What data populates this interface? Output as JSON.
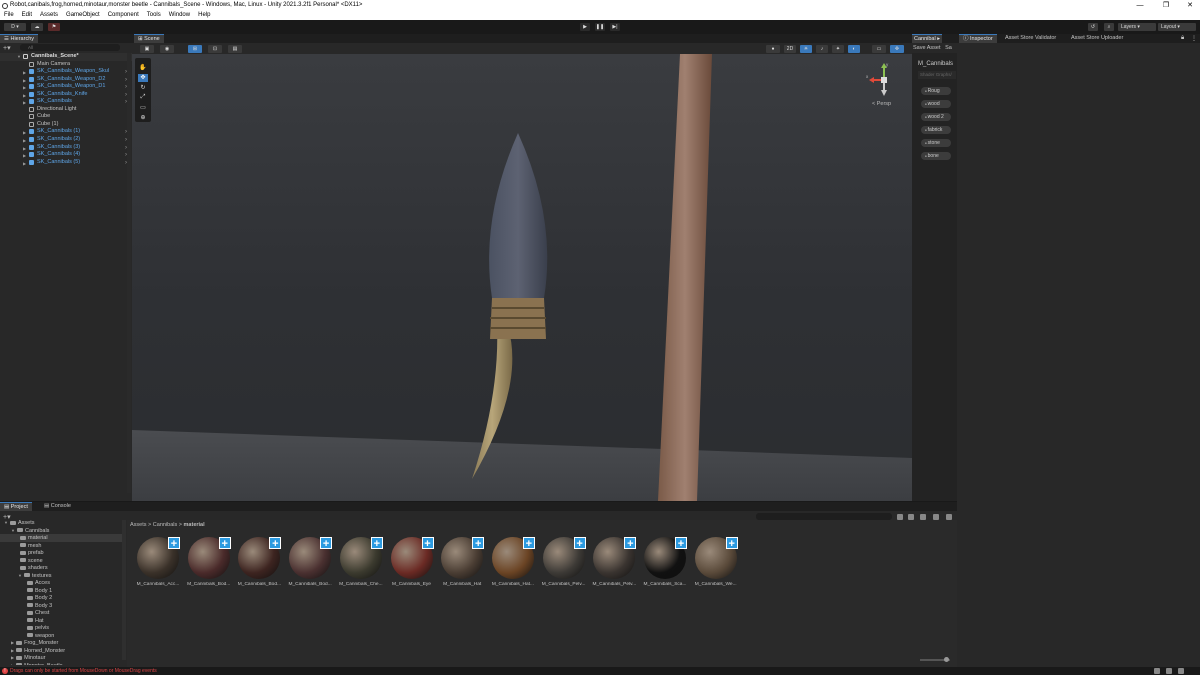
{
  "window": {
    "title": "Robot,canibals,frog,horned,minotaur,monster beetle - Cannibals_Scene - Windows, Mac, Linux - Unity 2021.3.2f1 Personal* <DX11>",
    "minimize": "—",
    "restore": "❐",
    "close": "✕"
  },
  "menu": [
    "File",
    "Edit",
    "Assets",
    "GameObject",
    "Component",
    "Tools",
    "Window",
    "Help"
  ],
  "toolbar": {
    "account": "D ▾",
    "layers": "Layers",
    "layout": "Layout"
  },
  "hierarchy": {
    "tab": "Hierarchy",
    "search_placeholder": "All",
    "scene": "Cannibals_Scene*",
    "items": [
      {
        "label": "Main Camera",
        "prefab": false,
        "expandable": false
      },
      {
        "label": "SK_Cannibals_Weapon_Skul",
        "prefab": true,
        "expandable": true
      },
      {
        "label": "SK_Cannibals_Weapon_D2",
        "prefab": true,
        "expandable": true
      },
      {
        "label": "SK_Cannibals_Weapon_D1",
        "prefab": true,
        "expandable": true
      },
      {
        "label": "SK_Cannibals_Knife",
        "prefab": true,
        "expandable": true
      },
      {
        "label": "SK_Cannibals",
        "prefab": true,
        "expandable": true
      },
      {
        "label": "Directional Light",
        "prefab": false,
        "expandable": false
      },
      {
        "label": "Cube",
        "prefab": false,
        "expandable": false
      },
      {
        "label": "Cube (1)",
        "prefab": false,
        "expandable": false
      },
      {
        "label": "SK_Cannibals (1)",
        "prefab": true,
        "expandable": true
      },
      {
        "label": "SK_Cannibals (2)",
        "prefab": true,
        "expandable": true
      },
      {
        "label": "SK_Cannibals (3)",
        "prefab": true,
        "expandable": true
      },
      {
        "label": "SK_Cannibals (4)",
        "prefab": true,
        "expandable": true
      },
      {
        "label": "SK_Cannibals (5)",
        "prefab": true,
        "expandable": true
      }
    ]
  },
  "scene": {
    "tab": "Scene",
    "persp": "< Persp",
    "gizmo_y": "y",
    "gizmo_x": "x"
  },
  "material_panel": {
    "tab": "Cannibal",
    "name": "M_Cannibals",
    "shader_placeholder": "Shader Graphs/",
    "save": "Save Asset",
    "save_as": "Sa",
    "properties": [
      "Roug",
      "wood",
      "wood 2",
      "fabrick",
      "stone",
      "bone"
    ]
  },
  "inspector": {
    "tabs": [
      "Inspector",
      "Asset Store Validator",
      "Asset Store Uploader"
    ]
  },
  "project": {
    "tabs": [
      "Project",
      "Console"
    ],
    "breadcrumb": [
      "Assets",
      "Cannibals",
      "material"
    ],
    "tree": [
      {
        "label": "Assets",
        "indent": 0,
        "selected": false
      },
      {
        "label": "Cannibals",
        "indent": 1,
        "selected": false
      },
      {
        "label": "material",
        "indent": 2,
        "selected": true
      },
      {
        "label": "mesh",
        "indent": 2,
        "selected": false
      },
      {
        "label": "prefab",
        "indent": 2,
        "selected": false
      },
      {
        "label": "scene",
        "indent": 2,
        "selected": false
      },
      {
        "label": "shaders",
        "indent": 2,
        "selected": false
      },
      {
        "label": "textures",
        "indent": 2,
        "selected": false
      },
      {
        "label": "Acces",
        "indent": 3,
        "selected": false
      },
      {
        "label": "Body 1",
        "indent": 3,
        "selected": false
      },
      {
        "label": "Body 2",
        "indent": 3,
        "selected": false
      },
      {
        "label": "Body 3",
        "indent": 3,
        "selected": false
      },
      {
        "label": "Chest",
        "indent": 3,
        "selected": false
      },
      {
        "label": "Hat",
        "indent": 3,
        "selected": false
      },
      {
        "label": "pelvis",
        "indent": 3,
        "selected": false
      },
      {
        "label": "weapon",
        "indent": 3,
        "selected": false
      },
      {
        "label": "Frog_Monster",
        "indent": 1,
        "selected": false
      },
      {
        "label": "Horned_Monster",
        "indent": 1,
        "selected": false
      },
      {
        "label": "Minotaur",
        "indent": 1,
        "selected": false
      },
      {
        "label": "Monster_Beetle",
        "indent": 1,
        "selected": false
      }
    ],
    "materials": [
      {
        "label": "M_Cannibals_Acc...",
        "color": "#3a3129"
      },
      {
        "label": "M_Cannibals_Bod...",
        "color": "#4a2a2a"
      },
      {
        "label": "M_Cannibals_Bod...",
        "color": "#3d2420"
      },
      {
        "label": "M_Cannibals_Bod...",
        "color": "#4a3030"
      },
      {
        "label": "M_Cannibals_Che...",
        "color": "#3b3a2e"
      },
      {
        "label": "M_Cannibals_Eye",
        "color": "#6b2a24"
      },
      {
        "label": "M_Cannibals_Hat",
        "color": "#4a3d33"
      },
      {
        "label": "M_Cannibals_Hat...",
        "color": "#6b4424"
      },
      {
        "label": "M_Cannibals_Pelv...",
        "color": "#3d3a36"
      },
      {
        "label": "M_Cannibals_Pelv...",
        "color": "#3a3430"
      },
      {
        "label": "M_Cannibals_Sca...",
        "color": "#111111"
      },
      {
        "label": "M_Cannibals_We...",
        "color": "#5a4a3a"
      }
    ]
  },
  "status": {
    "message": "Drags can only be started from MouseDown or MouseDrag events"
  },
  "colors": {
    "accent": "#3a79bb",
    "prefab": "#5fa6e8",
    "plus": "#2c9ae0",
    "error": "#dd4444"
  }
}
